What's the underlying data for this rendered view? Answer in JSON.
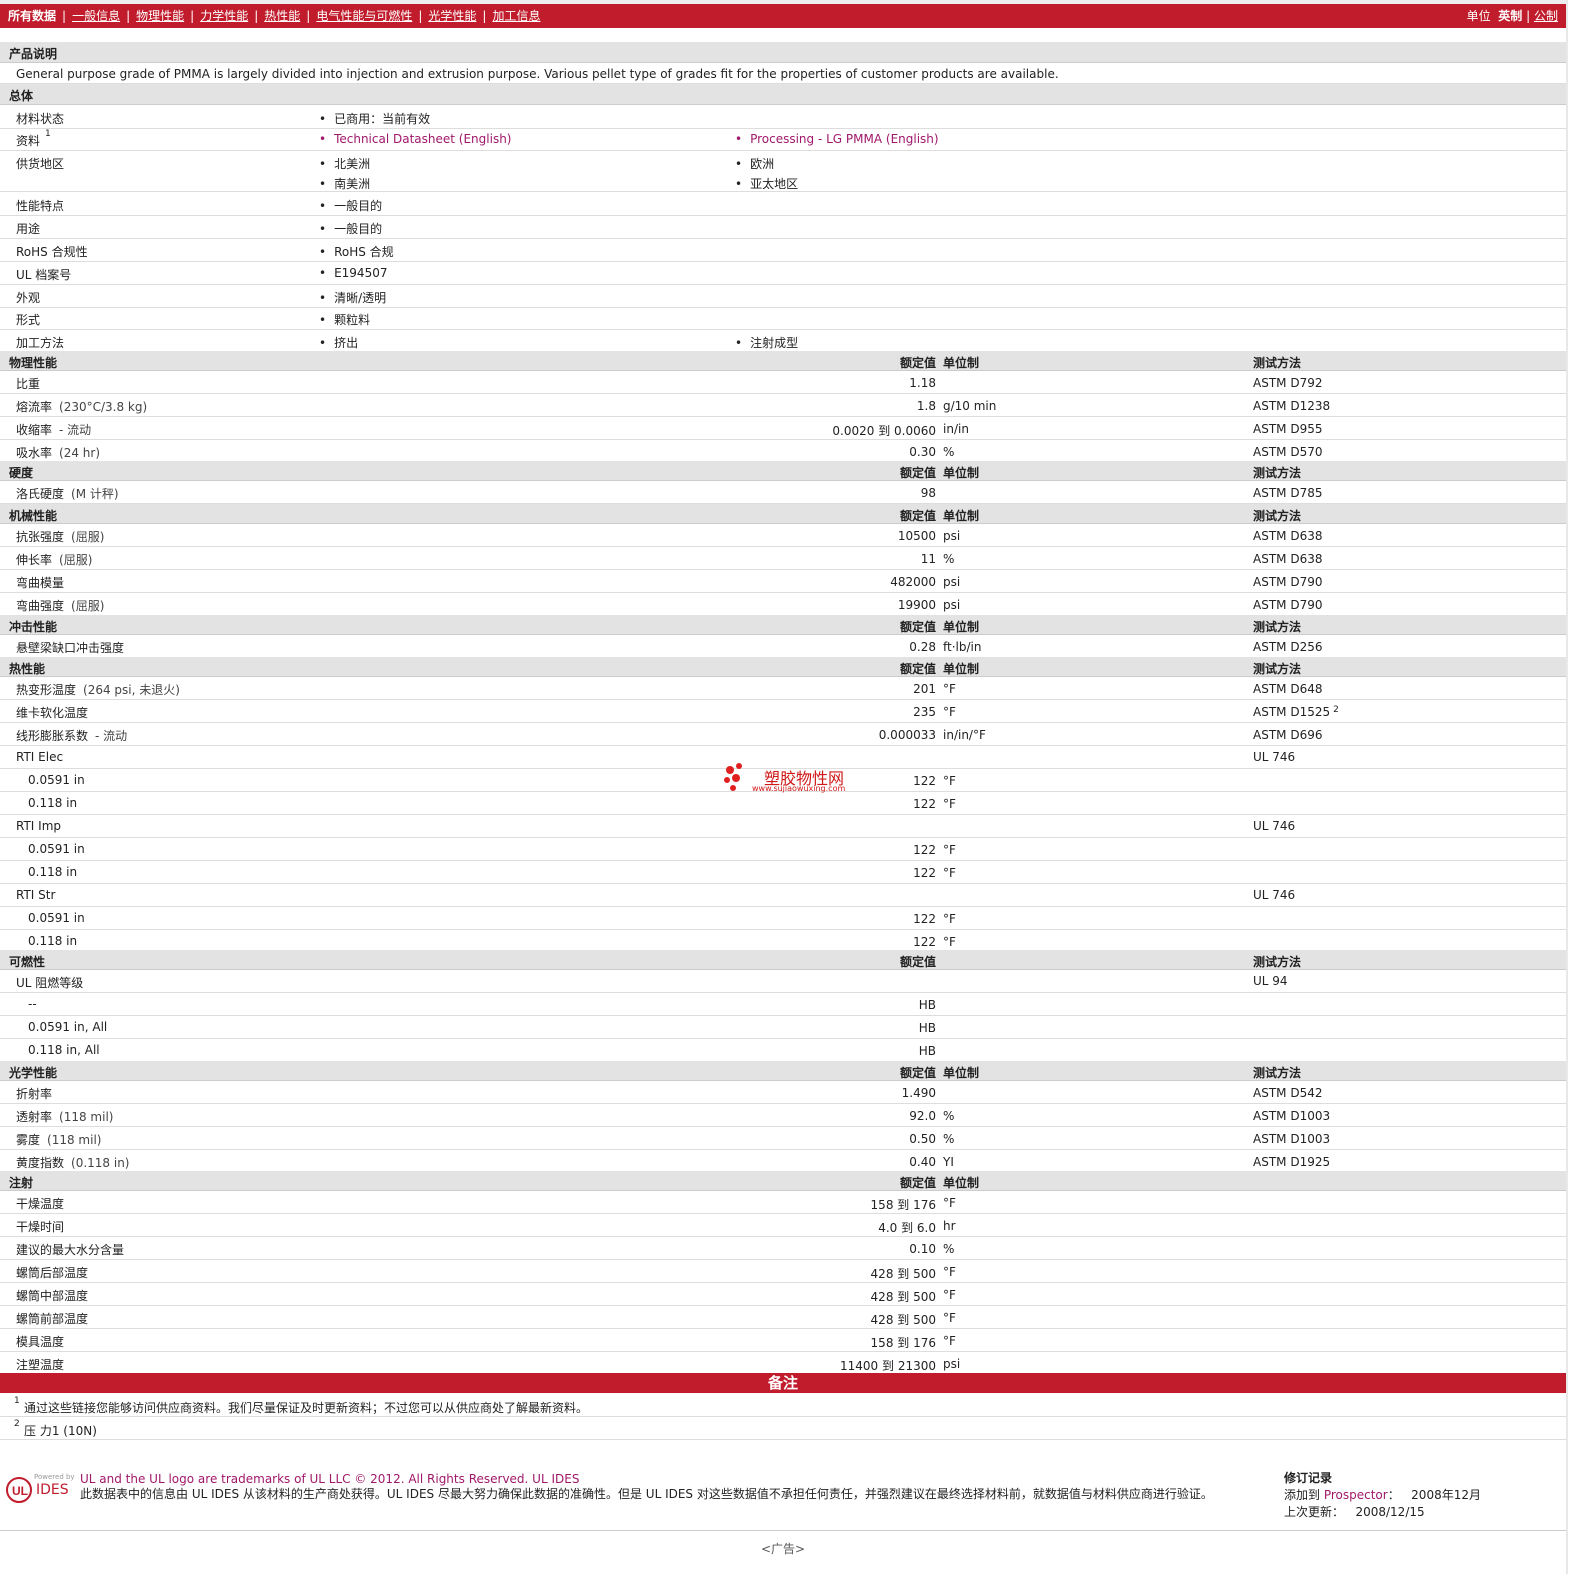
{
  "nav": {
    "tabs": [
      "所有数据",
      "一般信息",
      "物理性能",
      "力学性能",
      "热性能",
      "电气性能与可燃性",
      "光学性能",
      "加工信息"
    ],
    "units_label": "单位",
    "unit_english": "英制",
    "unit_metric": "公制"
  },
  "product": {
    "header": "产品说明",
    "desc": "General purpose grade of PMMA is largely divided into injection and extrusion purpose. Various pellet type of grades fit for the properties of customer products are available."
  },
  "general": {
    "header": "总体",
    "status_label": "材料状态",
    "status": "已商用：当前有效",
    "docs_label": "资料",
    "docs_sup": "1",
    "doc1": "Technical Datasheet (English)",
    "doc2": "Processing - LG PMMA (English)",
    "region_label": "供货地区",
    "region1": "北美洲",
    "region2": "欧洲",
    "region3": "南美洲",
    "region4": "亚太地区",
    "features_label": "性能特点",
    "features": "一般目的",
    "uses_label": "用途",
    "uses": "一般目的",
    "rohs_label": "RoHS 合规性",
    "rohs": "RoHS 合规",
    "ul_label": "UL 档案号",
    "ul": "E194507",
    "appearance_label": "外观",
    "appearance": "清晰/透明",
    "form_label": "形式",
    "form": "颗粒料",
    "proc_label": "加工方法",
    "proc1": "挤出",
    "proc2": "注射成型"
  },
  "h": {
    "value": "额定值",
    "unit": "单位制",
    "method": "测试方法"
  },
  "physical": {
    "header": "物理性能",
    "rows": [
      {
        "name": "比重",
        "cond": "",
        "value": "1.18",
        "unit": "",
        "method": "ASTM D792"
      },
      {
        "name": "熔流率",
        "cond": "(230°C/3.8 kg)",
        "value": "1.8",
        "unit": "g/10 min",
        "method": "ASTM D1238"
      },
      {
        "name": "收缩率",
        "cond": "- 流动",
        "value": "0.0020 到  0.0060",
        "unit": "in/in",
        "method": "ASTM D955"
      },
      {
        "name": "吸水率",
        "cond": "(24 hr)",
        "value": "0.30",
        "unit": "%",
        "method": "ASTM D570"
      }
    ]
  },
  "hardness": {
    "header": "硬度",
    "rows": [
      {
        "name": "洛氏硬度",
        "cond": "(M 计秤)",
        "value": "98",
        "unit": "",
        "method": "ASTM D785"
      }
    ]
  },
  "mechanical": {
    "header": "机械性能",
    "rows": [
      {
        "name": "抗张强度",
        "cond": "(屈服)",
        "value": "10500",
        "unit": "psi",
        "method": "ASTM D638"
      },
      {
        "name": "伸长率",
        "cond": "(屈服)",
        "value": "11",
        "unit": "%",
        "method": "ASTM D638"
      },
      {
        "name": "弯曲模量",
        "cond": "",
        "value": "482000",
        "unit": "psi",
        "method": "ASTM D790"
      },
      {
        "name": "弯曲强度",
        "cond": "(屈服)",
        "value": "19900",
        "unit": "psi",
        "method": "ASTM D790"
      }
    ]
  },
  "impact": {
    "header": "冲击性能",
    "rows": [
      {
        "name": "悬壁梁缺口冲击强度",
        "cond": "",
        "value": "0.28",
        "unit": "ft·lb/in",
        "method": "ASTM D256"
      }
    ]
  },
  "thermal": {
    "header": "热性能",
    "rows": [
      {
        "name": "热变形温度",
        "cond": "(264 psi, 未退火)",
        "value": "201",
        "unit": "°F",
        "method": "ASTM D648",
        "sup": ""
      },
      {
        "name": "维卡软化温度",
        "cond": "",
        "value": "235",
        "unit": "°F",
        "method": "ASTM D1525",
        "sup": "2"
      },
      {
        "name": "线形膨胀系数",
        "cond": "- 流动",
        "value": "0.000033",
        "unit": "in/in/°F",
        "method": "ASTM D696",
        "sup": ""
      }
    ],
    "rti": [
      {
        "name": "RTI Elec",
        "method": "UL 746",
        "subs": [
          {
            "t": "0.0591 in",
            "v": "122",
            "u": "°F"
          },
          {
            "t": "0.118 in",
            "v": "122",
            "u": "°F"
          }
        ]
      },
      {
        "name": "RTI Imp",
        "method": "UL 746",
        "subs": [
          {
            "t": "0.0591 in",
            "v": "122",
            "u": "°F"
          },
          {
            "t": "0.118 in",
            "v": "122",
            "u": "°F"
          }
        ]
      },
      {
        "name": "RTI Str",
        "method": "UL 746",
        "subs": [
          {
            "t": "0.0591 in",
            "v": "122",
            "u": "°F"
          },
          {
            "t": "0.118 in",
            "v": "122",
            "u": "°F"
          }
        ]
      }
    ]
  },
  "flammability": {
    "header": "可燃性",
    "name": "UL 阻燃等级",
    "method": "UL 94",
    "subs": [
      {
        "t": "--",
        "v": "HB"
      },
      {
        "t": "0.0591 in, All",
        "v": "HB"
      },
      {
        "t": "0.118 in, All",
        "v": "HB"
      }
    ]
  },
  "optical": {
    "header": "光学性能",
    "rows": [
      {
        "name": "折射率",
        "cond": "",
        "value": "1.490",
        "unit": "",
        "method": "ASTM D542"
      },
      {
        "name": "透射率",
        "cond": "(118 mil)",
        "value": "92.0",
        "unit": "%",
        "method": "ASTM D1003"
      },
      {
        "name": "雾度",
        "cond": "(118 mil)",
        "value": "0.50",
        "unit": "%",
        "method": "ASTM D1003"
      },
      {
        "name": "黄度指数",
        "cond": "(0.118 in)",
        "value": "0.40",
        "unit": "YI",
        "method": "ASTM D1925"
      }
    ]
  },
  "injection": {
    "header": "注射",
    "rows": [
      {
        "name": "干燥温度",
        "value": "158 到  176",
        "unit": "°F"
      },
      {
        "name": "干燥时间",
        "value": "4.0 到  6.0",
        "unit": "hr"
      },
      {
        "name": "建议的最大水分含量",
        "value": "0.10",
        "unit": "%"
      },
      {
        "name": "螺筒后部温度",
        "value": "428 到  500",
        "unit": "°F"
      },
      {
        "name": "螺筒中部温度",
        "value": "428 到  500",
        "unit": "°F"
      },
      {
        "name": "螺筒前部温度",
        "value": "428 到  500",
        "unit": "°F"
      },
      {
        "name": "模具温度",
        "value": "158 到  176",
        "unit": "°F"
      },
      {
        "name": "注塑温度",
        "value": "11400 到  21300",
        "unit": "psi"
      }
    ]
  },
  "notes": {
    "header": "备注",
    "n1_sup": "1",
    "n1": "通过这些链接您能够访问供应商资料。我们尽量保证及时更新资料；不过您可以从供应商处了解最新资料。",
    "n2_sup": "2",
    "n2": "压  力1 (10N)"
  },
  "watermark": {
    "title": "塑胶物性网",
    "url": "www.sujiaowuxing.com"
  },
  "footer": {
    "logo_small": "Powered by",
    "logo_text": "IDES",
    "line1": "UL and the UL logo are trademarks of UL LLC © 2012. All Rights Reserved. UL IDES",
    "line2": "此数据表中的信息由  UL IDES 从该材料的生产商处获得。UL IDES 尽最大努力确保此数据的准确性。但是  UL IDES 对这些数据值不承担任何责任，并强烈建议在最终选择材料前，就数据值与材料供应商进行验证。",
    "rev_title": "修订记录",
    "added_label": "添加到  ",
    "added_to": "Prospector",
    "added_colon": "：",
    "added_date": "2008年12月",
    "updated_label": "上次更新：",
    "updated_date": "2008/12/15",
    "ad": "<广告>"
  }
}
